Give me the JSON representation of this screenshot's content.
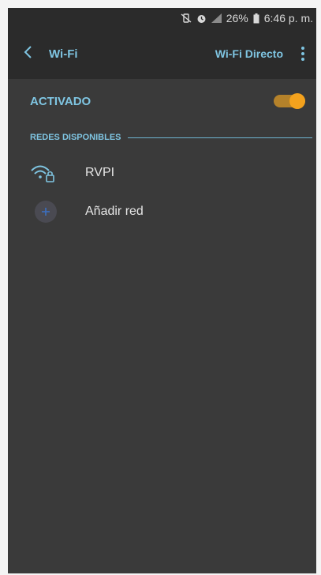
{
  "status_bar": {
    "battery": "26%",
    "time": "6:46 p. m.",
    "icons": [
      "mute-vibrate-icon",
      "alarm-icon",
      "signal-icon",
      "battery-icon"
    ]
  },
  "app_bar": {
    "title": "Wi-Fi",
    "wifi_direct_label": "Wi-Fi Directo",
    "icons": [
      "back-arrow-icon",
      "more-options-icon"
    ]
  },
  "wifi_toggle": {
    "label": "ACTIVADO",
    "on": true
  },
  "available_networks": {
    "header": "REDES DISPONIBLES",
    "items": [
      {
        "label": "RVPI",
        "icon": "wifi-locked-icon"
      },
      {
        "label": "Añadir red",
        "icon": "plus-icon"
      }
    ]
  },
  "colors": {
    "background": "#3a3a3a",
    "app_bar": "#2b2b2b",
    "accent_blue": "#7fc5e2",
    "toggle_orange": "#f4a21d",
    "text": "#e6e6e6"
  }
}
